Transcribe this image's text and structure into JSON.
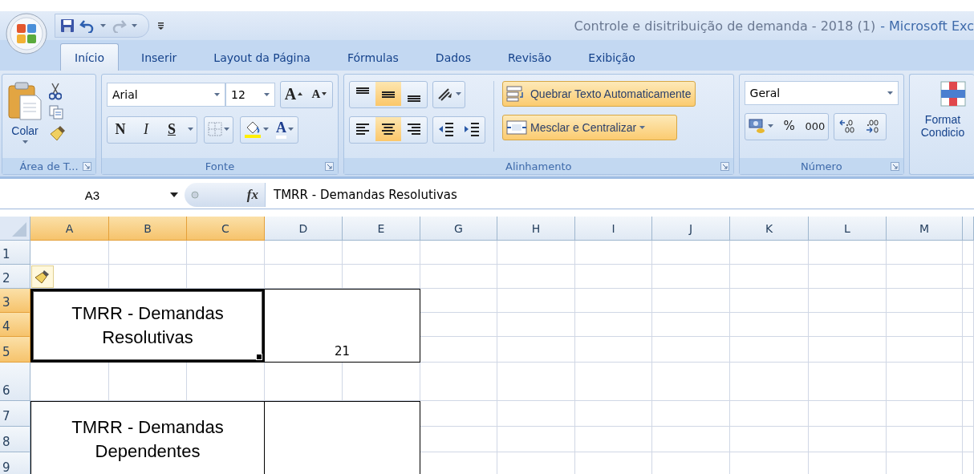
{
  "window": {
    "document": "Controle e disitribuição de demanda - 2018 (1)",
    "app": "- Microsoft Exc"
  },
  "tabs": [
    {
      "label": "Início",
      "selected": true
    },
    {
      "label": "Inserir",
      "selected": false
    },
    {
      "label": "Layout da Página",
      "selected": false
    },
    {
      "label": "Fórmulas",
      "selected": false
    },
    {
      "label": "Dados",
      "selected": false
    },
    {
      "label": "Revisão",
      "selected": false
    },
    {
      "label": "Exibição",
      "selected": false
    }
  ],
  "clipboard": {
    "paste": "Colar",
    "group_label": "Área de T..."
  },
  "font": {
    "name": "Arial",
    "size": "12",
    "grow": "A",
    "shrink": "A",
    "bold": "N",
    "italic": "I",
    "underline": "S",
    "color_letter": "A",
    "group_label": "Fonte"
  },
  "alignment": {
    "vertical": [
      {
        "selected": false
      },
      {
        "selected": true
      },
      {
        "selected": false
      }
    ],
    "horizontal": [
      {
        "selected": false
      },
      {
        "selected": true
      },
      {
        "selected": false
      }
    ],
    "wrap_text": {
      "label": "Quebrar Texto Automaticamente",
      "on": true
    },
    "merge": {
      "label": "Mesclar e Centralizar",
      "on": true
    },
    "group_label": "Alinhamento"
  },
  "number": {
    "format": "Geral",
    "percent": "%",
    "thousands": "000",
    "group_label": "Número"
  },
  "styles": {
    "label_lines": [
      "Format",
      "Condicio"
    ]
  },
  "formula_bar": {
    "name_box": "A3",
    "function_label": "fx",
    "content": "TMRR - Demandas Resolutivas"
  },
  "sheet": {
    "columns": [
      {
        "label": "A",
        "selected": true
      },
      {
        "label": "B",
        "selected": true
      },
      {
        "label": "C",
        "selected": true
      },
      {
        "label": "D",
        "selected": false
      },
      {
        "label": "E",
        "selected": false
      },
      {
        "label": "G",
        "selected": false
      },
      {
        "label": "H",
        "selected": false
      },
      {
        "label": "I",
        "selected": false
      },
      {
        "label": "J",
        "selected": false
      },
      {
        "label": "K",
        "selected": false
      },
      {
        "label": "L",
        "selected": false
      },
      {
        "label": "M",
        "selected": false
      }
    ],
    "rows": [
      {
        "label": "1",
        "selected": false
      },
      {
        "label": "2",
        "selected": false
      },
      {
        "label": "3",
        "selected": true
      },
      {
        "label": "4",
        "selected": true
      },
      {
        "label": "5",
        "selected": true
      },
      {
        "label": "6",
        "selected": false
      },
      {
        "label": "7",
        "selected": false
      },
      {
        "label": "8",
        "selected": false
      },
      {
        "label": "9",
        "selected": false
      }
    ],
    "blocks": [
      {
        "label": "TMRR - Demandas Resolutivas",
        "value": "21",
        "active": true
      },
      {
        "label": "TMRR - Demandas Dependentes",
        "active": false
      }
    ]
  }
}
